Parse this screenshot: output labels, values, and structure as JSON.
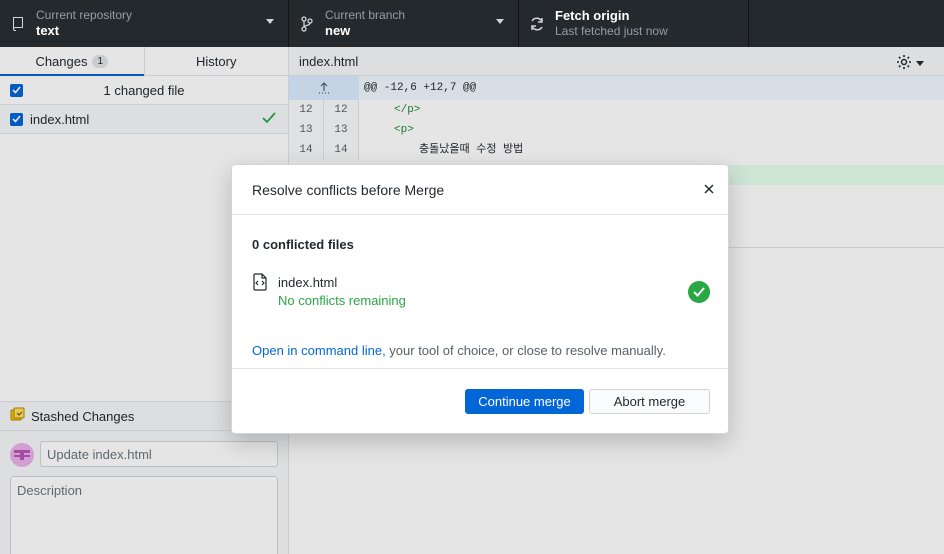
{
  "toolbar": {
    "repository": {
      "label": "Current repository",
      "value": "text"
    },
    "branch": {
      "label": "Current branch",
      "value": "new"
    },
    "fetch": {
      "label": "Fetch origin",
      "value": "Last fetched just now"
    }
  },
  "sidebar": {
    "tabs": [
      {
        "label": "Changes",
        "badge": "1"
      },
      {
        "label": "History"
      }
    ],
    "changes_header": "1 changed file",
    "files": [
      {
        "name": "index.html"
      }
    ],
    "stashed_label": "Stashed Changes",
    "commit": {
      "summary_placeholder": "Update index.html",
      "description_placeholder": "Description"
    }
  },
  "diff": {
    "path": "index.html",
    "hunk": "@@ -12,6 +12,7 @@",
    "lines": [
      {
        "old": "12",
        "new": "12",
        "code": "</p>"
      },
      {
        "old": "13",
        "new": "13",
        "code": "<p>"
      },
      {
        "old": "14",
        "new": "14",
        "code": "충돌났을때 수정 방법"
      }
    ]
  },
  "modal": {
    "title": "Resolve conflicts before Merge",
    "conflict_count": "0 conflicted files",
    "file_name": "index.html",
    "file_status": "No conflicts remaining",
    "hint_link": "Open in command line,",
    "hint_rest": " your tool of choice, or close to resolve manually.",
    "continue_label": "Continue merge",
    "abort_label": "Abort merge"
  },
  "colors": {
    "toolbar_bg": "#24292e",
    "accent": "#0366d6",
    "success": "#28a745"
  }
}
